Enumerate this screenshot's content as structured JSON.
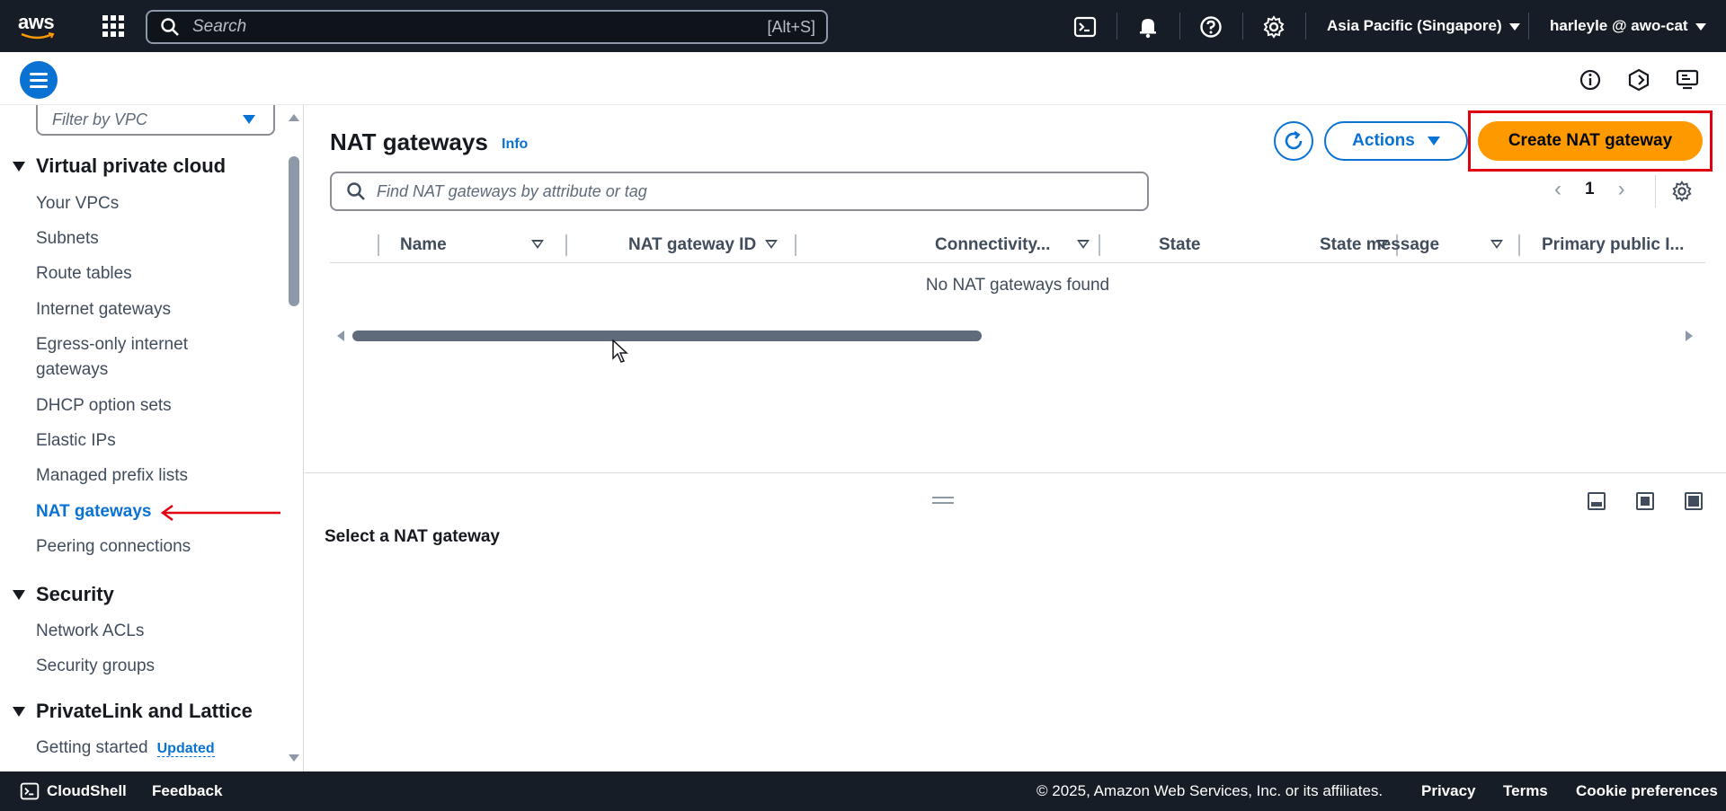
{
  "topnav": {
    "logo": "aws",
    "search_placeholder": "Search",
    "search_shortcut": "[Alt+S]",
    "region": "Asia Pacific (Singapore)",
    "account": "harleyle @ awo-cat"
  },
  "sidebar": {
    "filter_placeholder": "Filter by VPC",
    "sections": [
      {
        "title": "Virtual private cloud",
        "items": [
          "Your VPCs",
          "Subnets",
          "Route tables",
          "Internet gateways",
          "Egress-only internet gateways",
          "DHCP option sets",
          "Elastic IPs",
          "Managed prefix lists",
          "NAT gateways",
          "Peering connections"
        ]
      },
      {
        "title": "Security",
        "items": [
          "Network ACLs",
          "Security groups"
        ]
      },
      {
        "title": "PrivateLink and Lattice",
        "items": [
          "Getting started"
        ],
        "badge": "Updated"
      }
    ],
    "egress_line1": "Egress-only internet",
    "egress_line2": "gateways",
    "active_item": "NAT gateways"
  },
  "main": {
    "title": "NAT gateways",
    "info": "Info",
    "actions_label": "Actions",
    "create_label": "Create NAT gateway",
    "search_placeholder": "Find NAT gateways by attribute or tag",
    "page_number": "1",
    "columns": [
      "Name",
      "NAT gateway ID",
      "Connectivity...",
      "State",
      "State message",
      "Primary public I..."
    ],
    "empty_message": "No NAT gateways found",
    "split_message": "Select a NAT gateway"
  },
  "footer": {
    "cloudshell": "CloudShell",
    "feedback": "Feedback",
    "copyright": "© 2025, Amazon Web Services, Inc. or its affiliates.",
    "privacy": "Privacy",
    "terms": "Terms",
    "cookie": "Cookie preferences"
  },
  "colors": {
    "nav_bg": "#161d26",
    "accent_blue": "#0972d3",
    "primary_orange": "#ff9900",
    "highlight_red": "#e0000f"
  },
  "icons": [
    "grid-icon",
    "search-icon",
    "cloudshell-icon",
    "bell-icon",
    "help-icon",
    "gear-icon",
    "info-icon",
    "security-hub-icon",
    "screen-icon",
    "refresh-icon",
    "menu-icon"
  ]
}
